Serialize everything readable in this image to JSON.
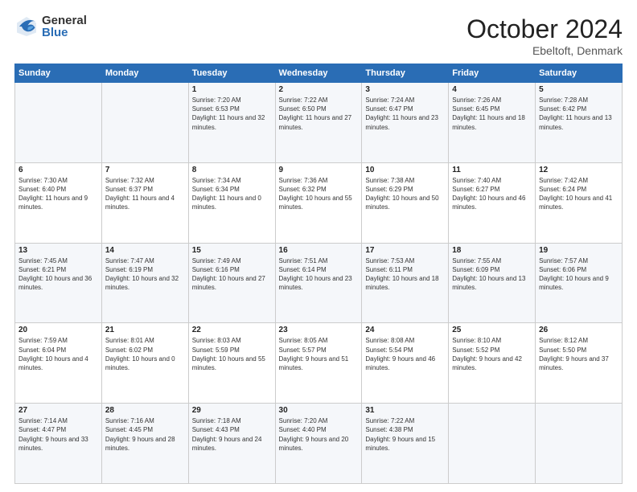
{
  "header": {
    "logo_general": "General",
    "logo_blue": "Blue",
    "month_title": "October 2024",
    "location": "Ebeltoft, Denmark"
  },
  "days_of_week": [
    "Sunday",
    "Monday",
    "Tuesday",
    "Wednesday",
    "Thursday",
    "Friday",
    "Saturday"
  ],
  "weeks": [
    [
      {
        "day": "",
        "info": ""
      },
      {
        "day": "",
        "info": ""
      },
      {
        "day": "1",
        "info": "Sunrise: 7:20 AM\nSunset: 6:53 PM\nDaylight: 11 hours and 32 minutes."
      },
      {
        "day": "2",
        "info": "Sunrise: 7:22 AM\nSunset: 6:50 PM\nDaylight: 11 hours and 27 minutes."
      },
      {
        "day": "3",
        "info": "Sunrise: 7:24 AM\nSunset: 6:47 PM\nDaylight: 11 hours and 23 minutes."
      },
      {
        "day": "4",
        "info": "Sunrise: 7:26 AM\nSunset: 6:45 PM\nDaylight: 11 hours and 18 minutes."
      },
      {
        "day": "5",
        "info": "Sunrise: 7:28 AM\nSunset: 6:42 PM\nDaylight: 11 hours and 13 minutes."
      }
    ],
    [
      {
        "day": "6",
        "info": "Sunrise: 7:30 AM\nSunset: 6:40 PM\nDaylight: 11 hours and 9 minutes."
      },
      {
        "day": "7",
        "info": "Sunrise: 7:32 AM\nSunset: 6:37 PM\nDaylight: 11 hours and 4 minutes."
      },
      {
        "day": "8",
        "info": "Sunrise: 7:34 AM\nSunset: 6:34 PM\nDaylight: 11 hours and 0 minutes."
      },
      {
        "day": "9",
        "info": "Sunrise: 7:36 AM\nSunset: 6:32 PM\nDaylight: 10 hours and 55 minutes."
      },
      {
        "day": "10",
        "info": "Sunrise: 7:38 AM\nSunset: 6:29 PM\nDaylight: 10 hours and 50 minutes."
      },
      {
        "day": "11",
        "info": "Sunrise: 7:40 AM\nSunset: 6:27 PM\nDaylight: 10 hours and 46 minutes."
      },
      {
        "day": "12",
        "info": "Sunrise: 7:42 AM\nSunset: 6:24 PM\nDaylight: 10 hours and 41 minutes."
      }
    ],
    [
      {
        "day": "13",
        "info": "Sunrise: 7:45 AM\nSunset: 6:21 PM\nDaylight: 10 hours and 36 minutes."
      },
      {
        "day": "14",
        "info": "Sunrise: 7:47 AM\nSunset: 6:19 PM\nDaylight: 10 hours and 32 minutes."
      },
      {
        "day": "15",
        "info": "Sunrise: 7:49 AM\nSunset: 6:16 PM\nDaylight: 10 hours and 27 minutes."
      },
      {
        "day": "16",
        "info": "Sunrise: 7:51 AM\nSunset: 6:14 PM\nDaylight: 10 hours and 23 minutes."
      },
      {
        "day": "17",
        "info": "Sunrise: 7:53 AM\nSunset: 6:11 PM\nDaylight: 10 hours and 18 minutes."
      },
      {
        "day": "18",
        "info": "Sunrise: 7:55 AM\nSunset: 6:09 PM\nDaylight: 10 hours and 13 minutes."
      },
      {
        "day": "19",
        "info": "Sunrise: 7:57 AM\nSunset: 6:06 PM\nDaylight: 10 hours and 9 minutes."
      }
    ],
    [
      {
        "day": "20",
        "info": "Sunrise: 7:59 AM\nSunset: 6:04 PM\nDaylight: 10 hours and 4 minutes."
      },
      {
        "day": "21",
        "info": "Sunrise: 8:01 AM\nSunset: 6:02 PM\nDaylight: 10 hours and 0 minutes."
      },
      {
        "day": "22",
        "info": "Sunrise: 8:03 AM\nSunset: 5:59 PM\nDaylight: 10 hours and 55 minutes."
      },
      {
        "day": "23",
        "info": "Sunrise: 8:05 AM\nSunset: 5:57 PM\nDaylight: 9 hours and 51 minutes."
      },
      {
        "day": "24",
        "info": "Sunrise: 8:08 AM\nSunset: 5:54 PM\nDaylight: 9 hours and 46 minutes."
      },
      {
        "day": "25",
        "info": "Sunrise: 8:10 AM\nSunset: 5:52 PM\nDaylight: 9 hours and 42 minutes."
      },
      {
        "day": "26",
        "info": "Sunrise: 8:12 AM\nSunset: 5:50 PM\nDaylight: 9 hours and 37 minutes."
      }
    ],
    [
      {
        "day": "27",
        "info": "Sunrise: 7:14 AM\nSunset: 4:47 PM\nDaylight: 9 hours and 33 minutes."
      },
      {
        "day": "28",
        "info": "Sunrise: 7:16 AM\nSunset: 4:45 PM\nDaylight: 9 hours and 28 minutes."
      },
      {
        "day": "29",
        "info": "Sunrise: 7:18 AM\nSunset: 4:43 PM\nDaylight: 9 hours and 24 minutes."
      },
      {
        "day": "30",
        "info": "Sunrise: 7:20 AM\nSunset: 4:40 PM\nDaylight: 9 hours and 20 minutes."
      },
      {
        "day": "31",
        "info": "Sunrise: 7:22 AM\nSunset: 4:38 PM\nDaylight: 9 hours and 15 minutes."
      },
      {
        "day": "",
        "info": ""
      },
      {
        "day": "",
        "info": ""
      }
    ]
  ]
}
